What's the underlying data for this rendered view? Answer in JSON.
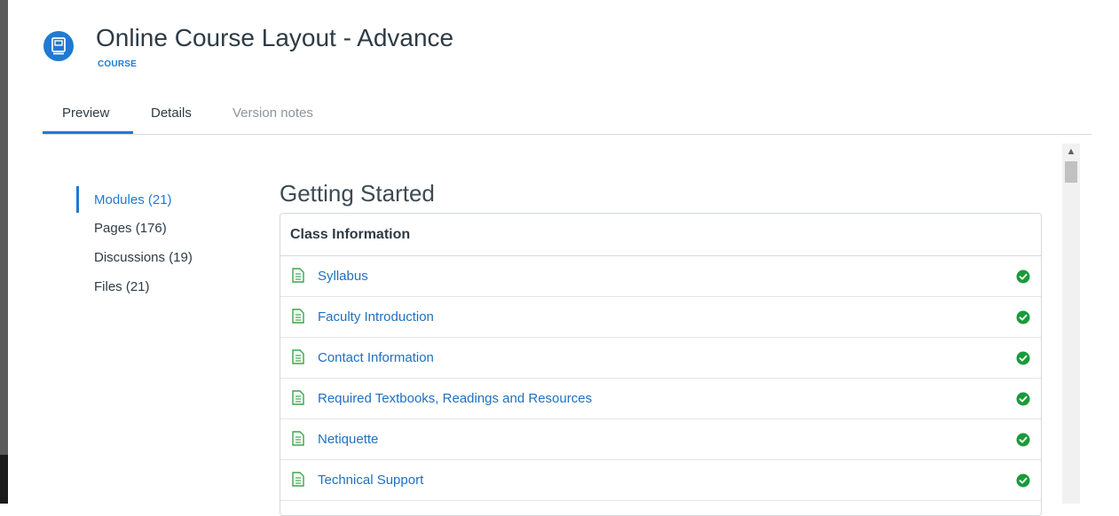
{
  "course": {
    "title": "Online Course Layout - Advance",
    "type_label": "COURSE",
    "icon": "course-book-icon"
  },
  "tabs": [
    {
      "label": "Preview",
      "active": true
    },
    {
      "label": "Details",
      "active": false
    },
    {
      "label": "Version notes",
      "active": false
    }
  ],
  "sidebar": {
    "items": [
      {
        "label": "Modules (21)",
        "active": true
      },
      {
        "label": "Pages (176)",
        "active": false
      },
      {
        "label": "Discussions (19)",
        "active": false
      },
      {
        "label": "Files (21)",
        "active": false
      }
    ]
  },
  "module": {
    "heading": "Getting Started",
    "section_title": "Class Information",
    "items": [
      {
        "label": "Syllabus",
        "icon": "page-icon",
        "status_icon": "check-circle-icon"
      },
      {
        "label": "Faculty Introduction",
        "icon": "page-icon",
        "status_icon": "check-circle-icon"
      },
      {
        "label": "Contact Information",
        "icon": "page-icon",
        "status_icon": "check-circle-icon"
      },
      {
        "label": "Required Textbooks, Readings and Resources",
        "icon": "page-icon",
        "status_icon": "check-circle-icon"
      },
      {
        "label": "Netiquette",
        "icon": "page-icon",
        "status_icon": "check-circle-icon"
      },
      {
        "label": "Technical Support",
        "icon": "page-icon",
        "status_icon": "check-circle-icon"
      }
    ]
  },
  "colors": {
    "accent": "#1f7ad2",
    "link": "#1f70c1",
    "success": "#1a9a3a",
    "page_icon": "#3aa64a"
  }
}
